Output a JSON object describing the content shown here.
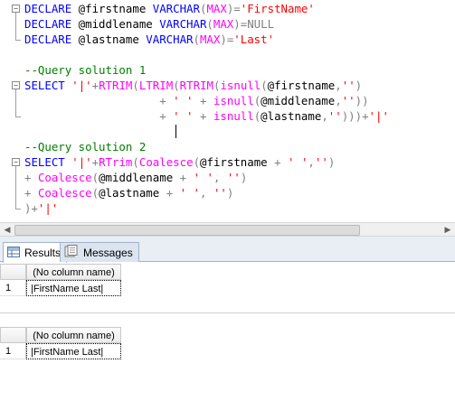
{
  "editor": {
    "line1": {
      "kw1": "DECLARE",
      "v": " @firstname ",
      "kw2": "VARCHAR",
      "p1": "(",
      "fn": "MAX",
      "p2": ")",
      "eq": "=",
      "s": "'FirstName'"
    },
    "line2": {
      "kw1": "DECLARE",
      "v": " @middlename ",
      "kw2": "VARCHAR",
      "p1": "(",
      "fn": "MAX",
      "p2": ")",
      "eq": "=",
      "n": "NULL"
    },
    "line3": {
      "kw1": "DECLARE",
      "v": " @lastname ",
      "kw2": "VARCHAR",
      "p1": "(",
      "fn": "MAX",
      "p2": ")",
      "eq": "=",
      "s": "'Last'"
    },
    "comment1": "--Query solution 1",
    "comment2": "--Query solution 2"
  },
  "tabs": {
    "results": "Results",
    "messages": "Messages"
  },
  "grid1": {
    "column": "(No column name)",
    "row_number": "1",
    "value": "|FirstName Last|"
  },
  "grid2": {
    "column": "(No column name)",
    "row_number": "1",
    "value": "|FirstName Last|"
  },
  "icons": {
    "results_tab": "grid-icon",
    "messages_tab": "messages-icon"
  }
}
